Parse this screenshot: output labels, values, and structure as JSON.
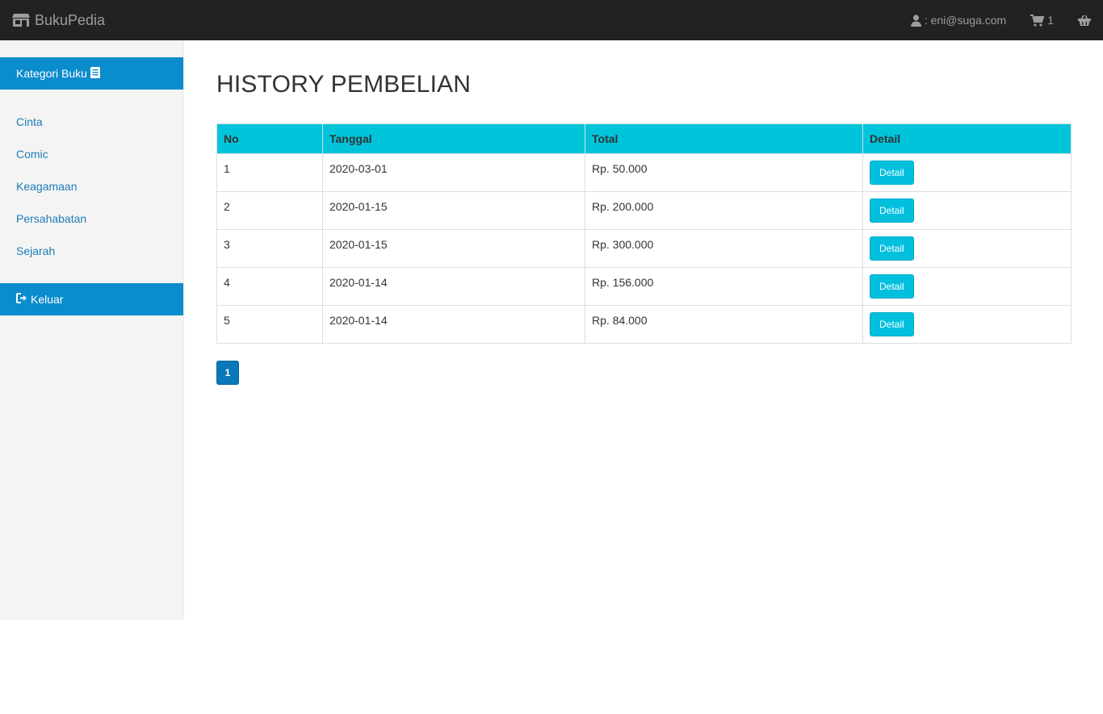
{
  "navbar": {
    "brand": "BukuPedia",
    "user_email": ": eni@suga.com",
    "cart_count": "1"
  },
  "sidebar": {
    "header": "Kategori Buku",
    "categories": [
      "Cinta",
      "Comic",
      "Keagamaan",
      "Persahabatan",
      "Sejarah"
    ],
    "logout_label": "Keluar"
  },
  "main": {
    "title": "HISTORY PEMBELIAN",
    "table": {
      "headers": [
        "No",
        "Tanggal",
        "Total",
        "Detail"
      ],
      "rows": [
        {
          "no": "1",
          "tanggal": "2020-03-01",
          "total": "Rp. 50.000",
          "detail": "Detail"
        },
        {
          "no": "2",
          "tanggal": "2020-01-15",
          "total": "Rp. 200.000",
          "detail": "Detail"
        },
        {
          "no": "3",
          "tanggal": "2020-01-15",
          "total": "Rp. 300.000",
          "detail": "Detail"
        },
        {
          "no": "4",
          "tanggal": "2020-01-14",
          "total": "Rp. 156.000",
          "detail": "Detail"
        },
        {
          "no": "5",
          "tanggal": "2020-01-14",
          "total": "Rp. 84.000",
          "detail": "Detail"
        }
      ]
    },
    "pagination": {
      "current_page": "1"
    }
  },
  "colors": {
    "navbar_bg": "#222222",
    "accent_blue": "#0b8ccc",
    "table_header": "#00c5da",
    "button": "#00c0de",
    "link": "#1e7cb8"
  },
  "icons": {
    "brand": "store-icon",
    "user": "user-icon",
    "cart": "cart-icon",
    "basket": "basket-icon",
    "book": "book-icon",
    "logout": "sign-out-icon"
  }
}
